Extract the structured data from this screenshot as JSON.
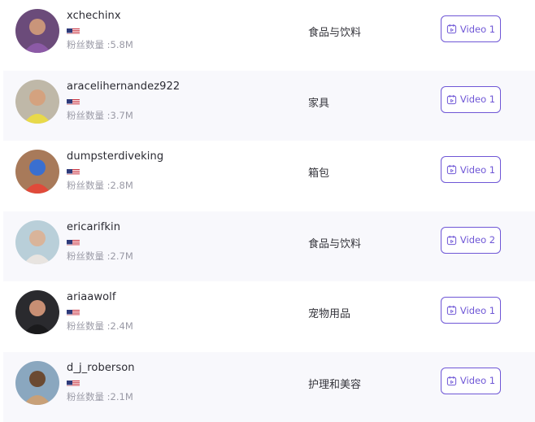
{
  "creators": [
    {
      "username": "xchechinx",
      "country": "US",
      "fans_label": "粉丝数量",
      "fans_value": "5.8M",
      "category": "食品与饮料",
      "video_label": "Video 1",
      "avatar": {
        "bg": "#6b4b7a",
        "skin": "#c9957a",
        "accent": "#8c5aa6"
      }
    },
    {
      "username": "aracelihernandez922",
      "country": "US",
      "fans_label": "粉丝数量",
      "fans_value": "3.7M",
      "category": "家具",
      "video_label": "Video 1",
      "avatar": {
        "bg": "#bfb8a8",
        "skin": "#d4a27f",
        "accent": "#e8d94a"
      }
    },
    {
      "username": "dumpsterdiveking",
      "country": "US",
      "fans_label": "粉丝数量",
      "fans_value": "2.8M",
      "category": "箱包",
      "video_label": "Video 1",
      "avatar": {
        "bg": "#a87a5a",
        "skin": "#3a6fd0",
        "accent": "#e04a3a"
      }
    },
    {
      "username": "ericarifkin",
      "country": "US",
      "fans_label": "粉丝数量",
      "fans_value": "2.7M",
      "category": "食品与饮料",
      "video_label": "Video 2",
      "avatar": {
        "bg": "#b9cfd9",
        "skin": "#d9b49a",
        "accent": "#e8e4e0"
      }
    },
    {
      "username": "ariaawolf",
      "country": "US",
      "fans_label": "粉丝数量",
      "fans_value": "2.4M",
      "category": "宠物用品",
      "video_label": "Video 1",
      "avatar": {
        "bg": "#2a2a2e",
        "skin": "#c88f74",
        "accent": "#1a1a1c"
      }
    },
    {
      "username": "d_j_roberson",
      "country": "US",
      "fans_label": "粉丝数量",
      "fans_value": "2.1M",
      "category": "护理和美容",
      "video_label": "Video 1",
      "avatar": {
        "bg": "#8aa7bf",
        "skin": "#6b4a32",
        "accent": "#c8a078"
      }
    }
  ],
  "colors": {
    "accent": "#6f57d6",
    "alt_row": "#f8f8fc",
    "muted_text": "#9a9aa6"
  }
}
